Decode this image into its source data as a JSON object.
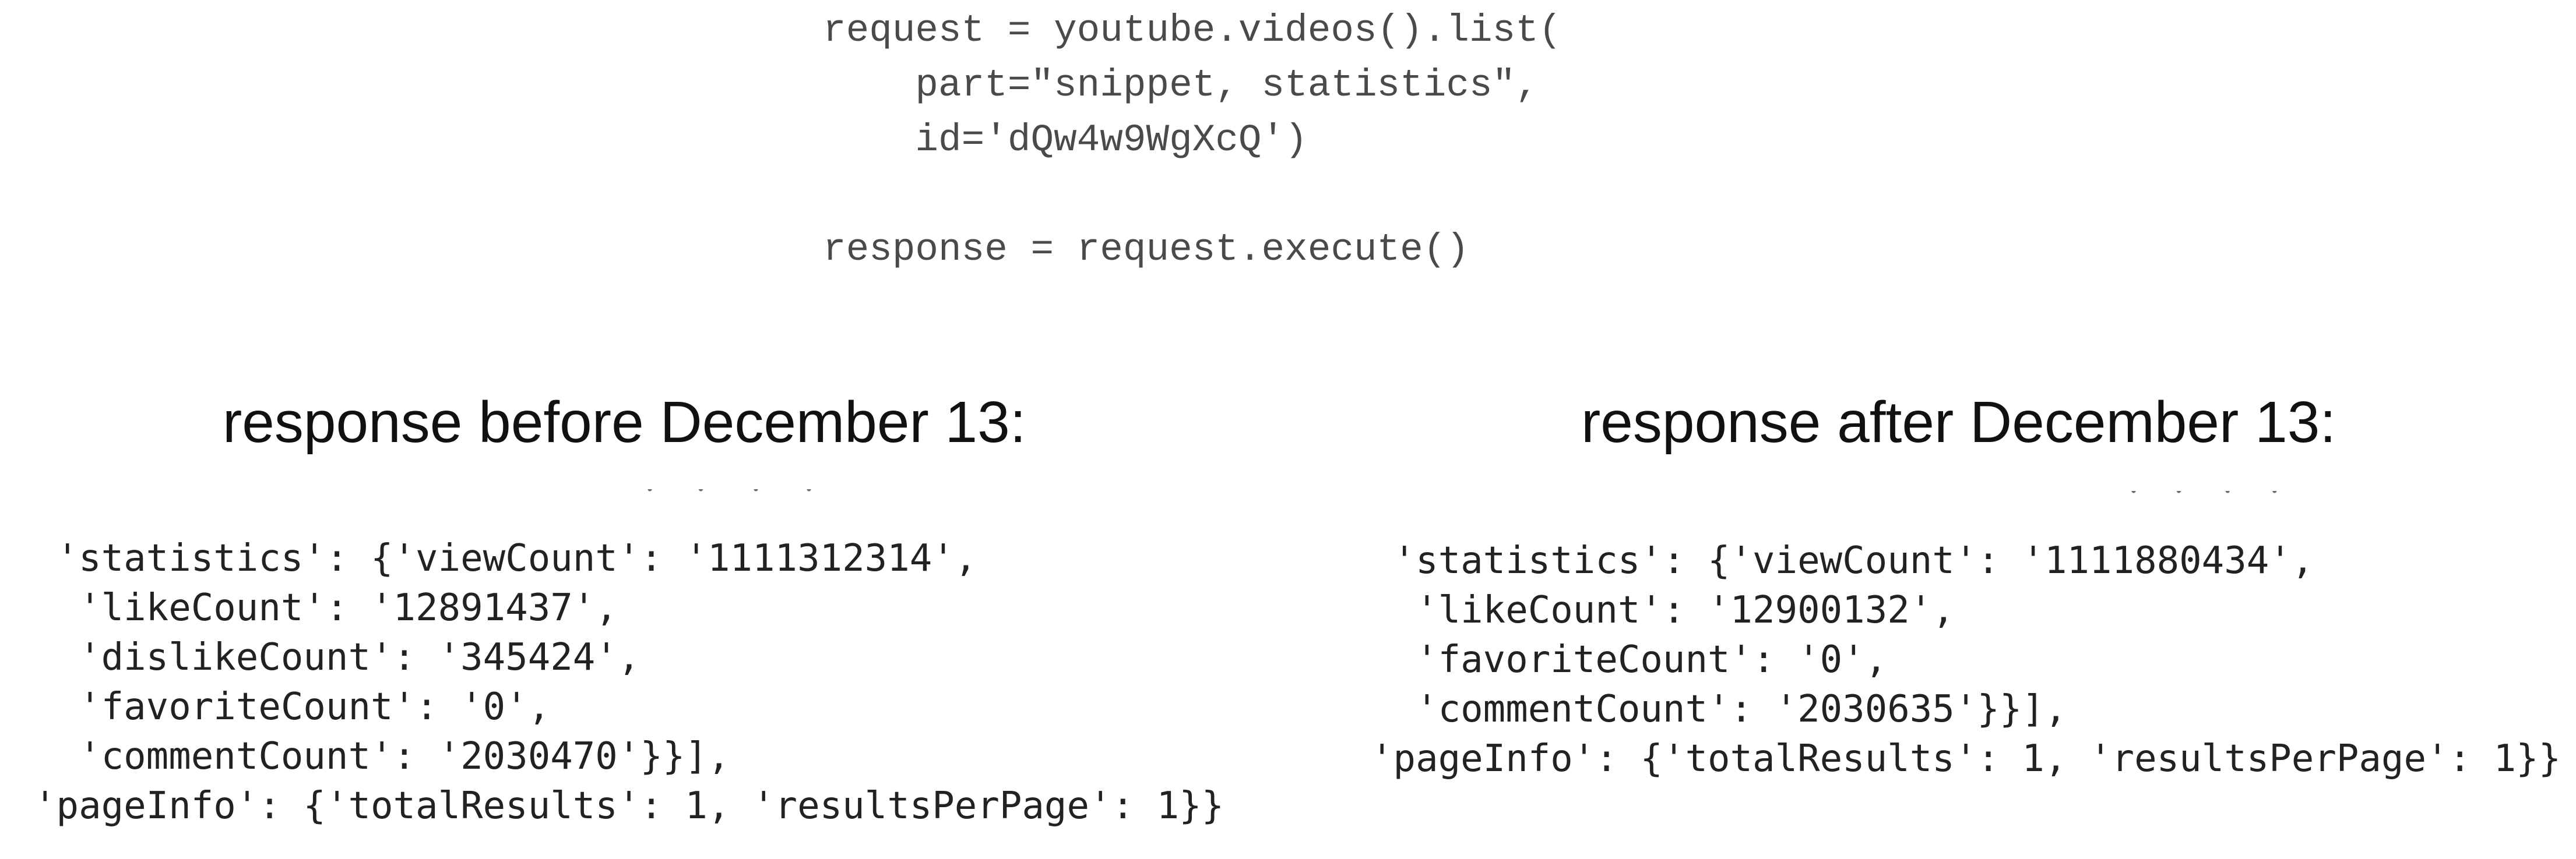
{
  "request_code": {
    "lines": [
      "request = youtube.videos().list(",
      "    part=\"snippet, statistics\",",
      "    id='dQw4w9WgXcQ')",
      "",
      "response = request.execute()"
    ]
  },
  "before": {
    "heading": "response before December 13:",
    "lines": [
      " 'statistics': {'viewCount': '1111312314',",
      "  'likeCount': '12891437',",
      "  'dislikeCount': '345424',",
      "  'favoriteCount': '0',",
      "  'commentCount': '2030470'}}],",
      "'pageInfo': {'totalResults': 1, 'resultsPerPage': 1}}"
    ]
  },
  "after": {
    "heading": "response after December 13:",
    "lines": [
      " 'statistics': {'viewCount': '1111880434',",
      "  'likeCount': '12900132',",
      "  'favoriteCount': '0',",
      "  'commentCount': '2030635'}}],",
      "'pageInfo': {'totalResults': 1, 'resultsPerPage': 1}}"
    ]
  }
}
